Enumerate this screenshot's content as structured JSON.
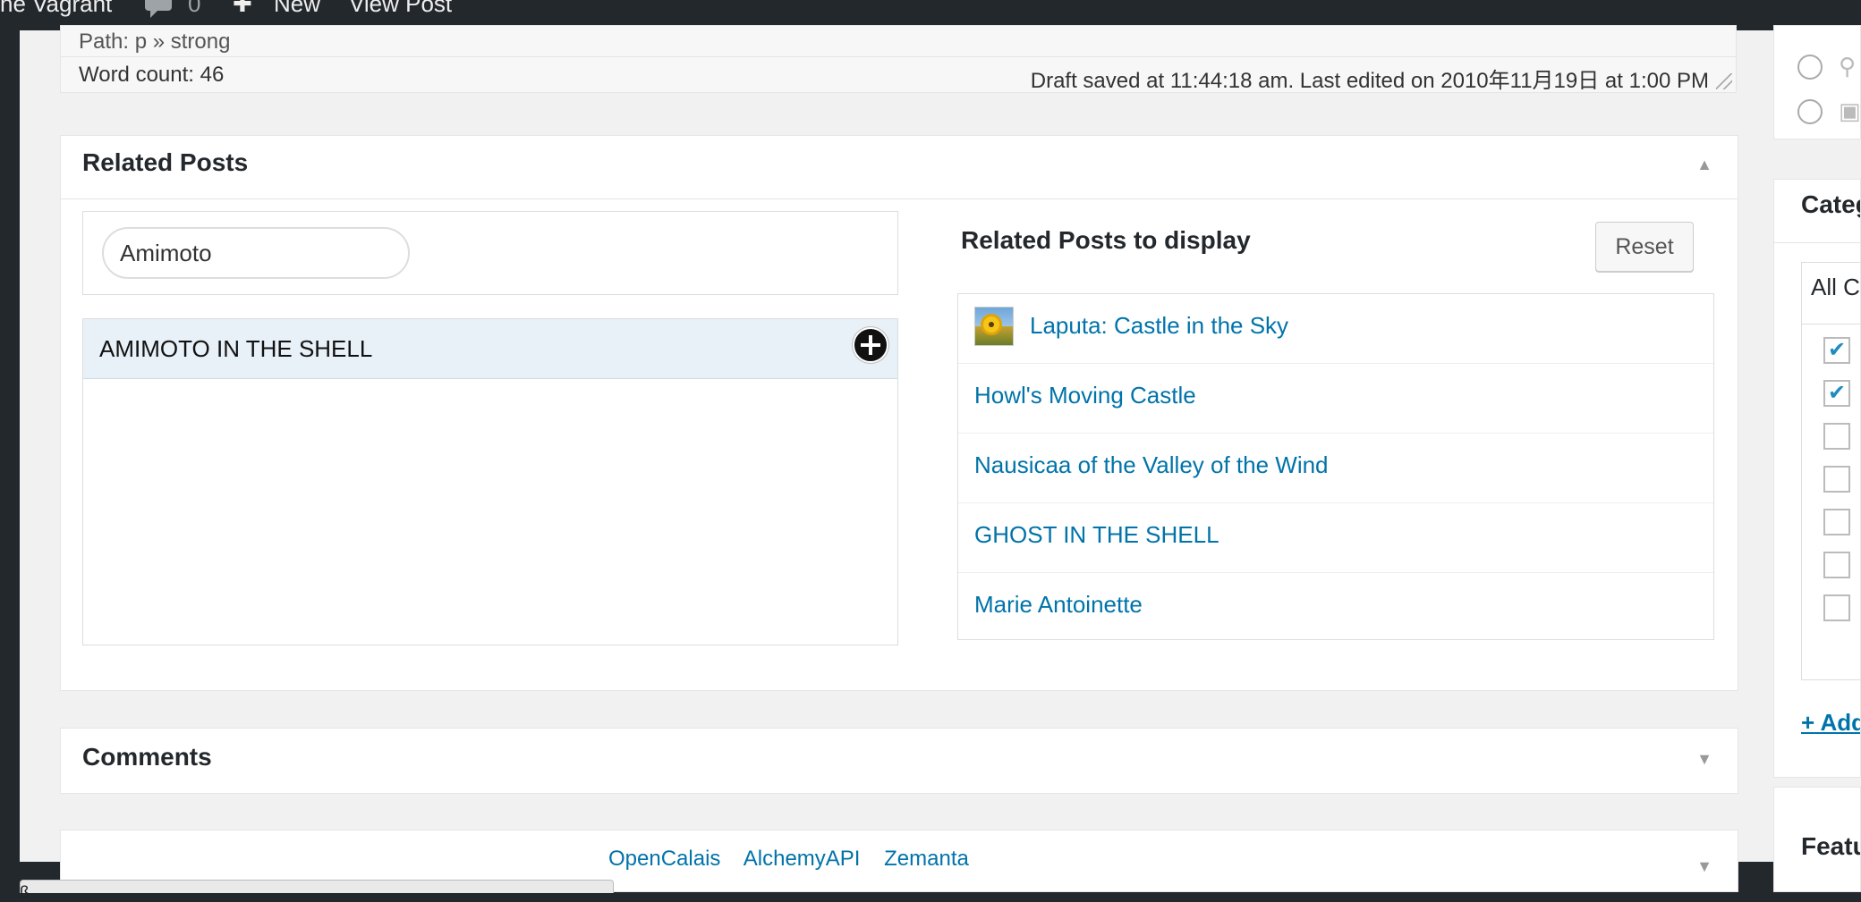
{
  "admin_bar": {
    "site_name": "he Vagrant",
    "comments_count": "0",
    "new_label": "New",
    "view_post_label": "View Post"
  },
  "editor_status": {
    "path": "Path: p » strong",
    "word_count": "Word count: 46",
    "draft_status": "Draft saved at 11:44:18 am. Last edited on 2010年11月19日 at 1:00 PM"
  },
  "related_posts": {
    "title": "Related Posts",
    "search": {
      "value": "Amimoto",
      "placeholder": ""
    },
    "results": [
      {
        "title": "AMIMOTO IN THE SHELL"
      }
    ],
    "display_title": "Related Posts to display",
    "reset_label": "Reset",
    "display_items": [
      {
        "title": "Laputa: Castle in the Sky",
        "has_thumbnail": true
      },
      {
        "title": "Howl's Moving Castle"
      },
      {
        "title": "Nausicaa of the Valley of the Wind"
      },
      {
        "title": "GHOST IN THE SHELL"
      },
      {
        "title": "Marie Antoinette"
      }
    ]
  },
  "comments": {
    "title": "Comments"
  },
  "next_box": {
    "links_text": "OpenCalais    AlchemyAPI    Zemanta"
  },
  "sidebar": {
    "categories": {
      "title": "Categ",
      "tab_all": "All Ca",
      "checkboxes": [
        true,
        true,
        false,
        false,
        false,
        false,
        false
      ],
      "add_link": "+ Add"
    },
    "featured": {
      "title": "Featu"
    }
  },
  "colors": {
    "link": "#0073aa",
    "admin_bar": "#23282d",
    "highlight_row": "#e8f0f8"
  }
}
